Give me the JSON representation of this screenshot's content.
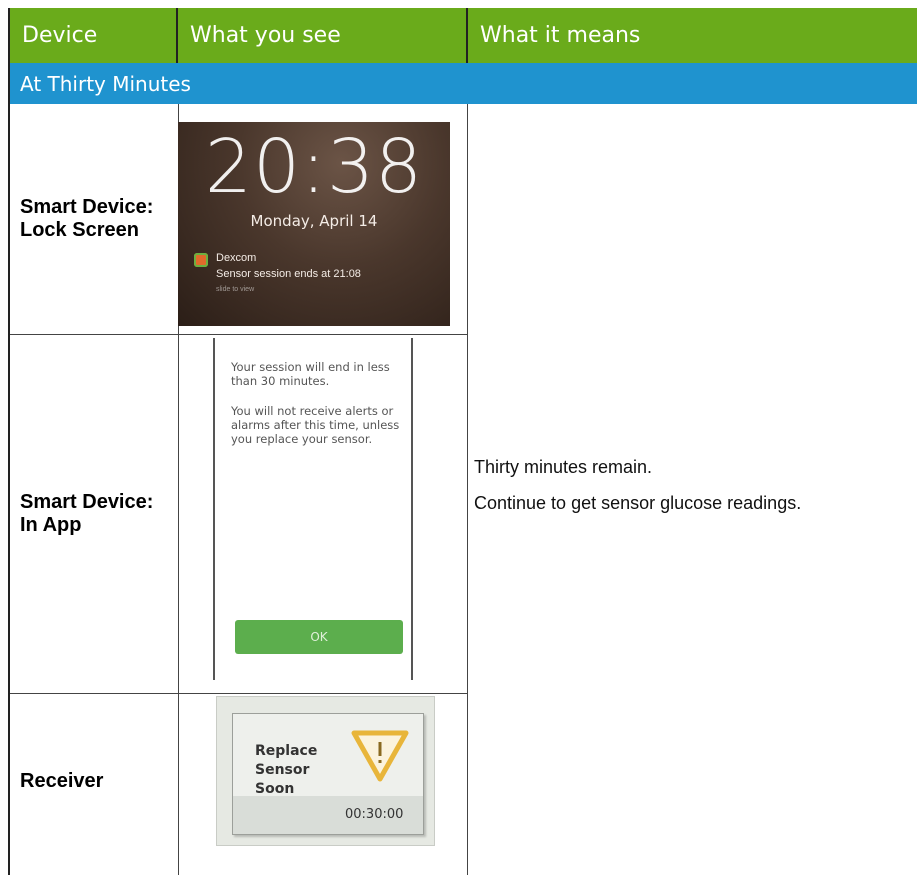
{
  "header": {
    "col_device": "Device",
    "col_see": "What you see",
    "col_means": "What it means"
  },
  "section": {
    "title": "At Thirty Minutes"
  },
  "rows": [
    {
      "device": "Smart Device: Lock Screen"
    },
    {
      "device": "Smart Device: In App"
    },
    {
      "device": "Receiver"
    }
  ],
  "lock_screen": {
    "time": "20:38",
    "date": "Monday, April 14",
    "app": "Dexcom",
    "message": "Sensor session ends at 21:08",
    "hint": "slide to view"
  },
  "in_app": {
    "line1": "Your session will end in less than 30 minutes.",
    "line2": "You will not receive alerts or alarms after this time, unless you replace your sensor.",
    "ok_label": "OK"
  },
  "receiver": {
    "line1": "Replace",
    "line2": "Sensor",
    "line3": "Soon",
    "timer": "00:30:00"
  },
  "meaning": {
    "line1": "Thirty minutes remain.",
    "line2": "Continue to get sensor glucose readings."
  },
  "colors": {
    "header_green": "#6aab1b",
    "section_blue": "#1f93cf",
    "ok_green": "#5cae4d",
    "warning_yellow": "#e8b53a"
  }
}
